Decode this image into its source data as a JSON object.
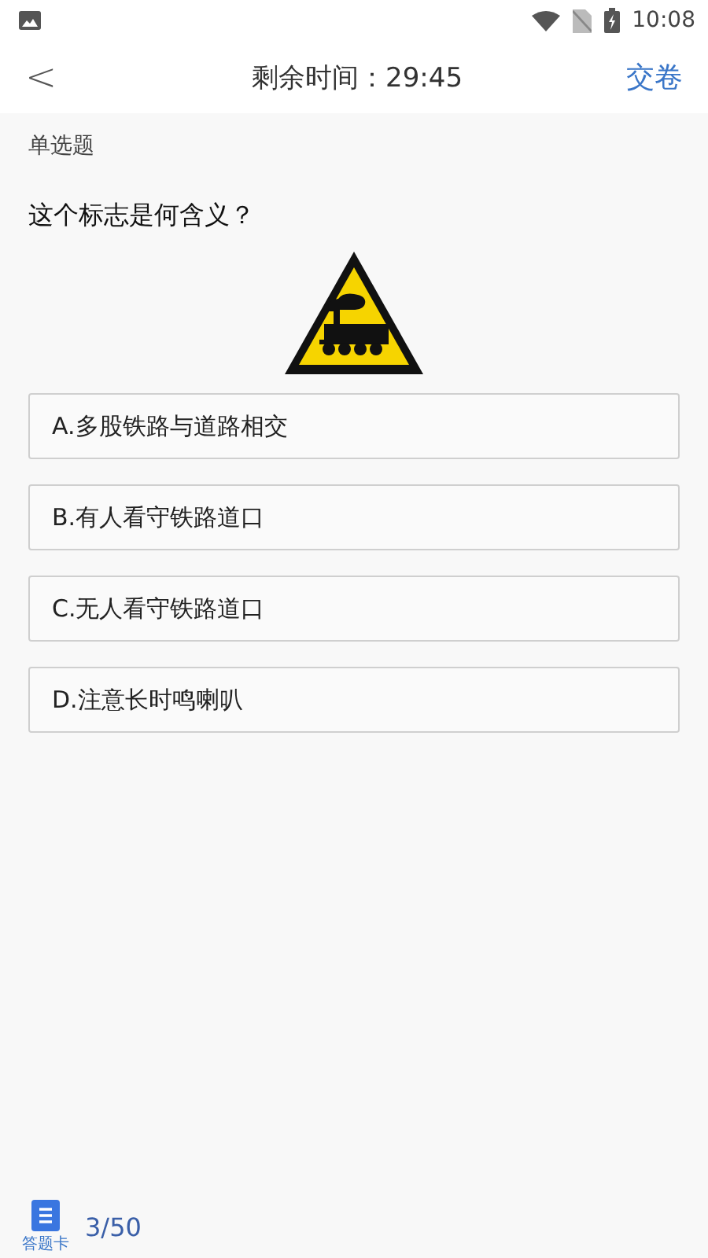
{
  "status_bar": {
    "time": "10:08"
  },
  "header": {
    "back": "<",
    "title": "剩余时间：29:45",
    "submit": "交卷"
  },
  "question": {
    "type": "单选题",
    "text": "这个标志是何含义？"
  },
  "options": [
    {
      "label": "A.多股铁路与道路相交"
    },
    {
      "label": "B.有人看守铁路道口"
    },
    {
      "label": "C.无人看守铁路道口"
    },
    {
      "label": "D.注意长时鸣喇叭"
    }
  ],
  "footer": {
    "card_label": "答题卡",
    "progress": "3/50"
  }
}
